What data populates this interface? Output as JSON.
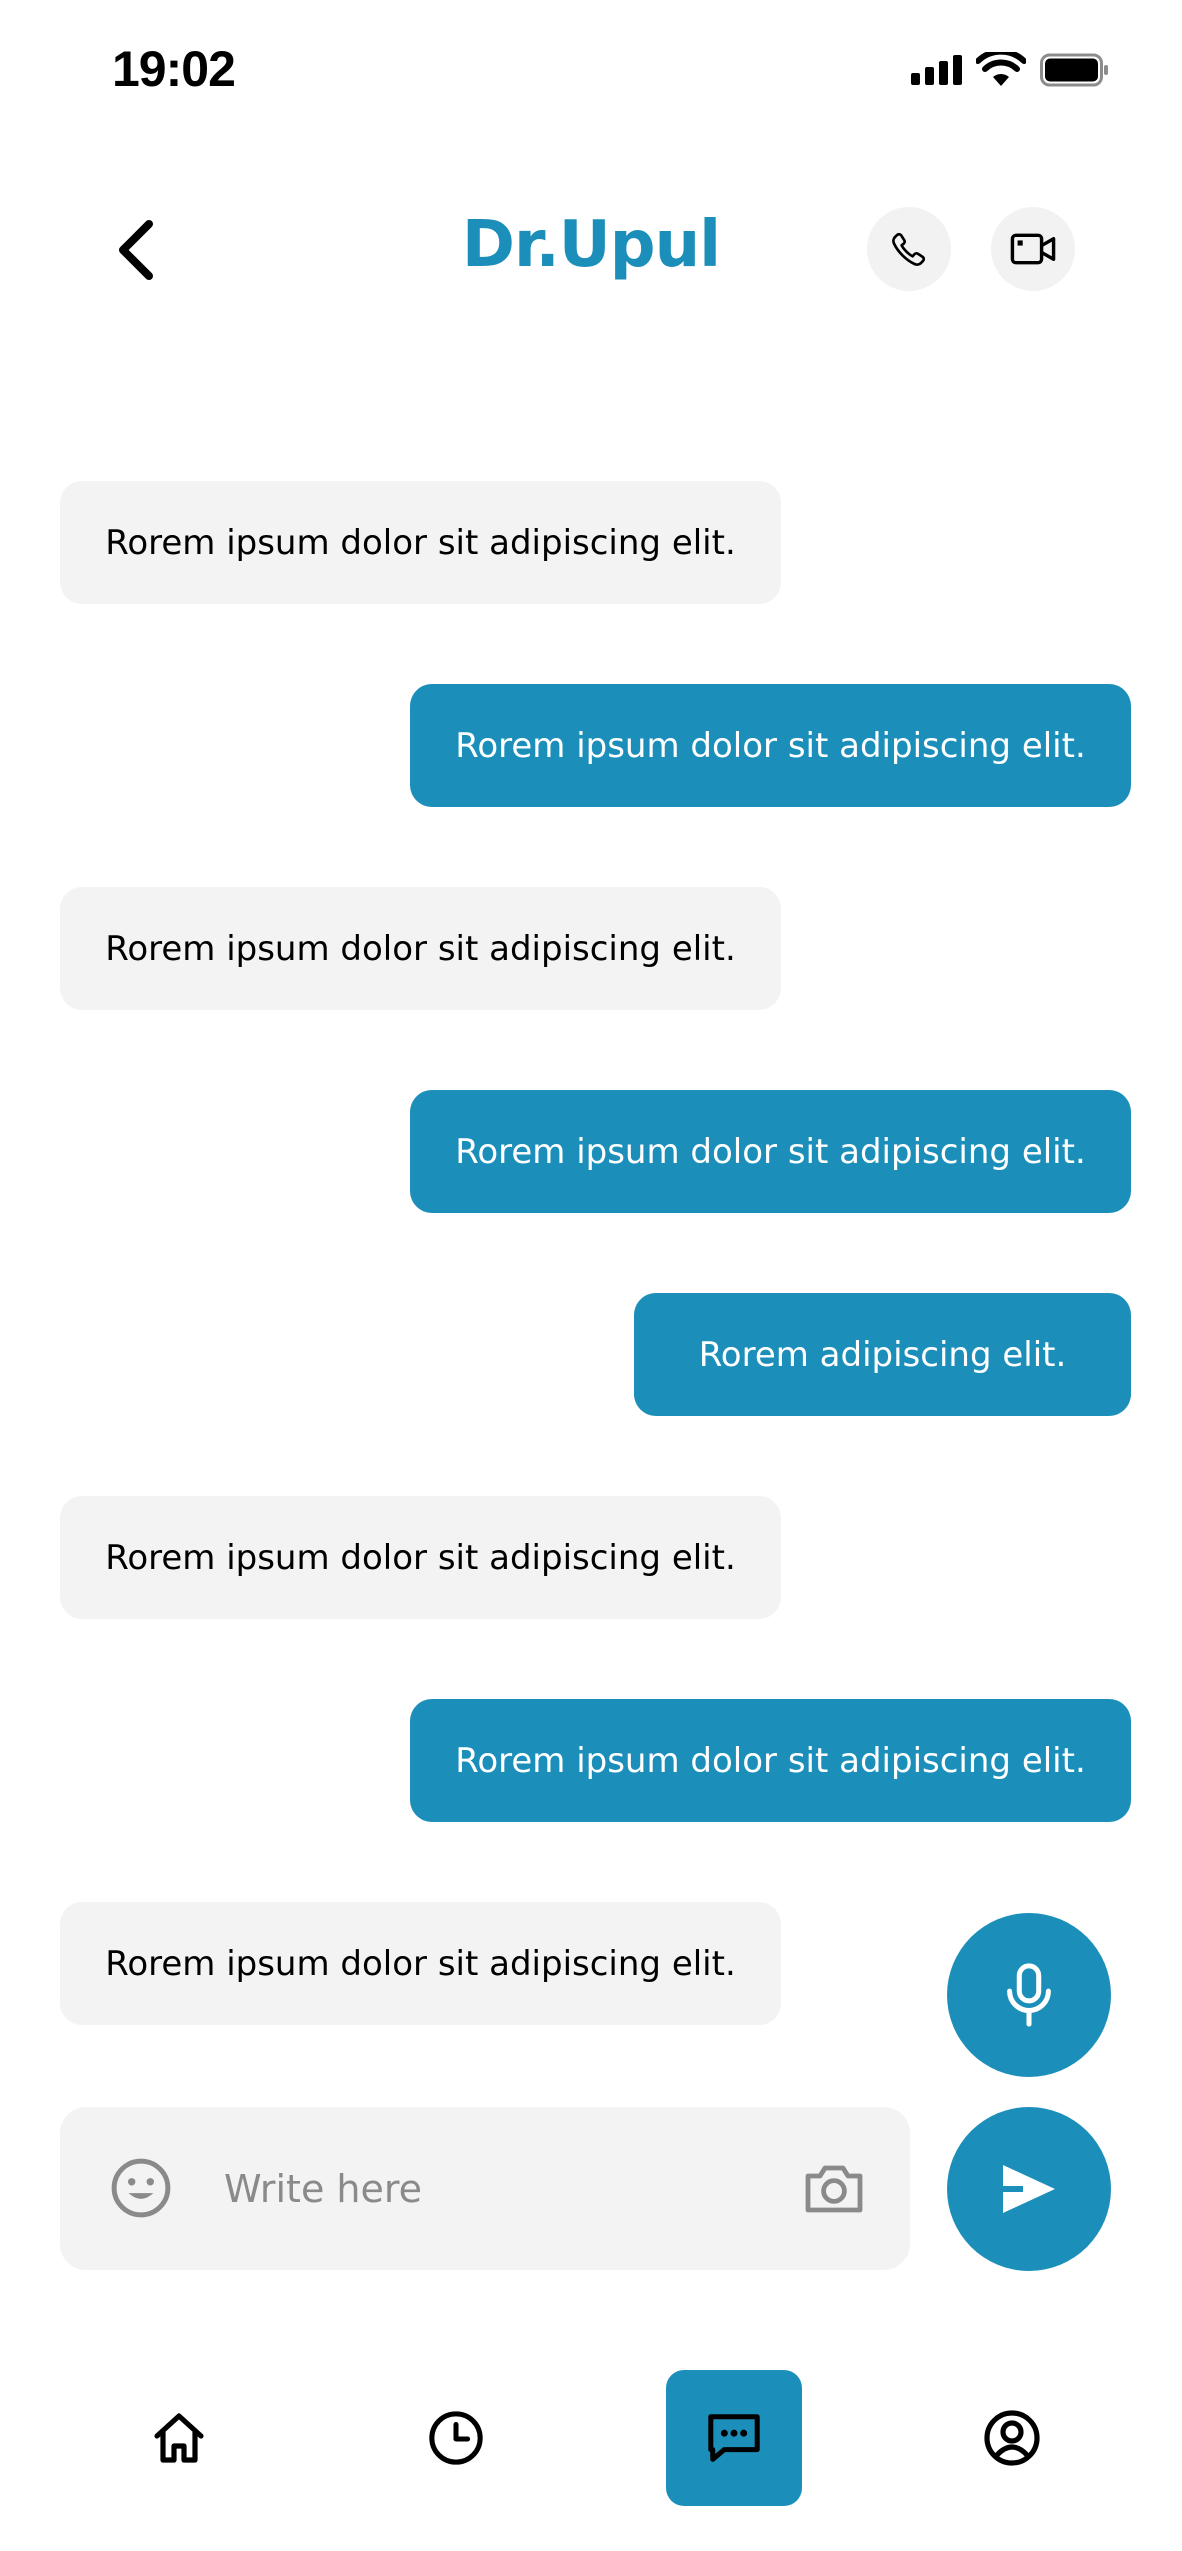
{
  "status_bar": {
    "time": "19:02",
    "icons": [
      "signal-icon",
      "wifi-icon",
      "battery-icon"
    ]
  },
  "header": {
    "title": "Dr.Upul",
    "back_icon": "chevron-left-icon",
    "call_icon": "phone-icon",
    "video_icon": "video-camera-icon"
  },
  "messages": [
    {
      "direction": "incoming",
      "text": "Rorem ipsum dolor sit  adipiscing elit."
    },
    {
      "direction": "outgoing",
      "text": "Rorem ipsum dolor sit  adipiscing elit."
    },
    {
      "direction": "incoming",
      "text": "Rorem ipsum dolor sit  adipiscing elit."
    },
    {
      "direction": "outgoing",
      "text": "Rorem ipsum dolor sit  adipiscing elit."
    },
    {
      "direction": "outgoing",
      "text": "Rorem adipiscing elit."
    },
    {
      "direction": "incoming",
      "text": "Rorem ipsum dolor sit  adipiscing elit."
    },
    {
      "direction": "outgoing",
      "text": "Rorem ipsum dolor sit  adipiscing elit."
    },
    {
      "direction": "incoming",
      "text": "Rorem ipsum dolor sit  adipiscing elit."
    }
  ],
  "composer": {
    "placeholder": "Write here",
    "value": "",
    "emoji_icon": "emoji-icon",
    "camera_icon": "camera-icon",
    "mic_icon": "microphone-icon",
    "send_icon": "send-icon"
  },
  "bottom_nav": {
    "items": [
      {
        "name": "home",
        "icon": "home-icon"
      },
      {
        "name": "history",
        "icon": "clock-icon"
      },
      {
        "name": "chat",
        "icon": "chat-icon",
        "active": true
      },
      {
        "name": "profile",
        "icon": "user-circle-icon"
      }
    ]
  },
  "colors": {
    "accent": "#1b8fba",
    "incoming_bubble": "#f3f3f3",
    "background": "#ffffff"
  }
}
